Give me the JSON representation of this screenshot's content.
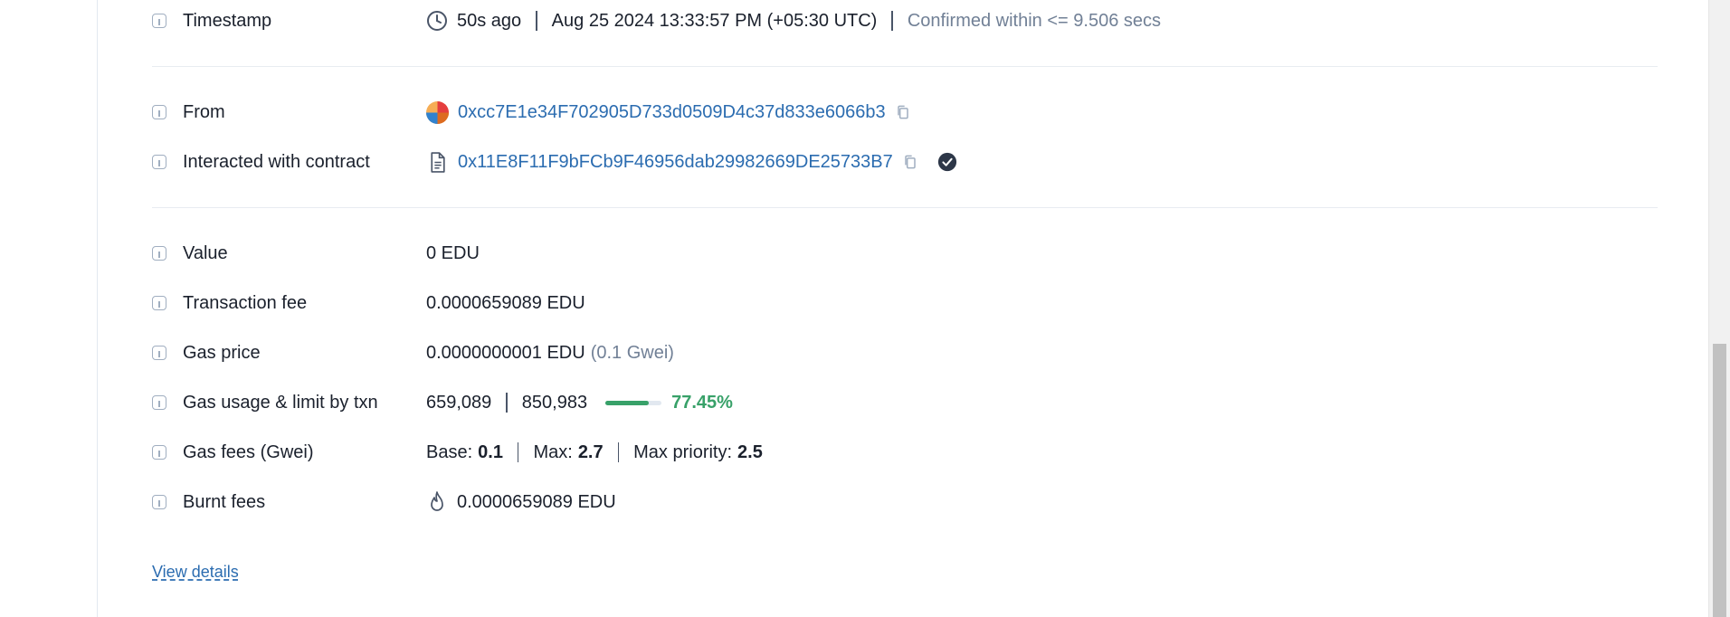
{
  "rows": {
    "timestamp": {
      "label": "Timestamp",
      "ago": "50s ago",
      "datetime": "Aug 25 2024 13:33:57 PM (+05:30 UTC)",
      "confirmed": "Confirmed within <= 9.506 secs"
    },
    "from": {
      "label": "From",
      "address": "0xcc7E1e34F702905D733d0509D4c37d833e6066b3"
    },
    "contract": {
      "label": "Interacted with contract",
      "address": "0x11E8F11F9bFCb9F46956dab29982669DE25733B7"
    },
    "value": {
      "label": "Value",
      "amount": "0 EDU"
    },
    "fee": {
      "label": "Transaction fee",
      "amount": "0.0000659089 EDU"
    },
    "gas_price": {
      "label": "Gas price",
      "amount": "0.0000000001 EDU",
      "gwei": "(0.1 Gwei)"
    },
    "gas_usage": {
      "label": "Gas usage & limit by txn",
      "used": "659,089",
      "limit": "850,983",
      "percent_text": "77.45%",
      "percent": 77.45
    },
    "gas_fees": {
      "label": "Gas fees (Gwei)",
      "base_label": "Base:",
      "base": "0.1",
      "max_label": "Max:",
      "max": "2.7",
      "priority_label": "Max priority:",
      "priority": "2.5"
    },
    "burnt": {
      "label": "Burnt fees",
      "amount": "0.0000659089 EDU"
    }
  },
  "view_details": "View details",
  "icons": {
    "info": "info-icon",
    "clock": "clock-icon",
    "copy": "copy-icon",
    "contract": "document-icon",
    "verified": "verified-check-icon",
    "flame": "flame-icon",
    "avatar": "address-avatar"
  },
  "colors": {
    "link": "#2b6cb0",
    "success": "#38a169",
    "muted": "#718096"
  }
}
